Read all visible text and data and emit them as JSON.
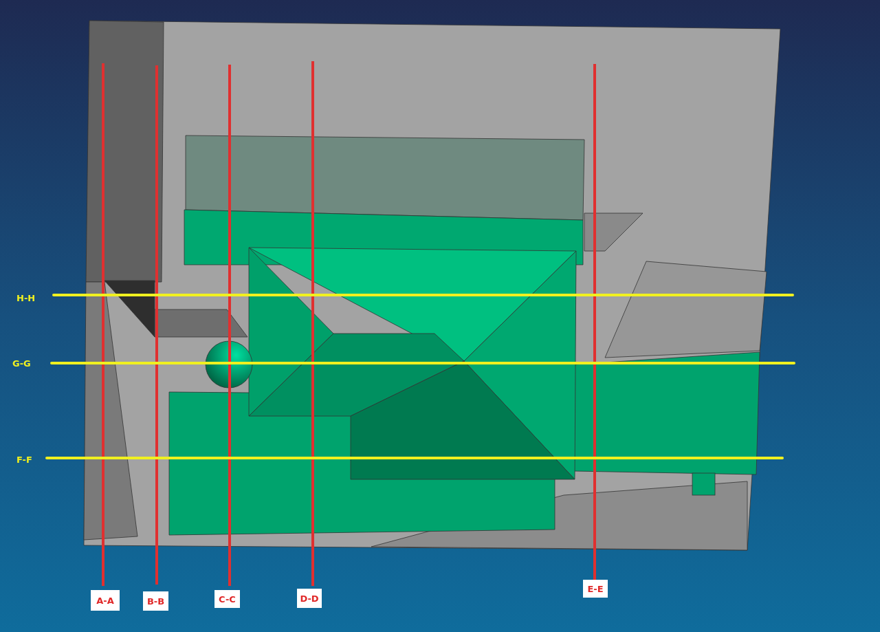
{
  "vertical_sections": [
    {
      "label": "A-A"
    },
    {
      "label": "B-B"
    },
    {
      "label": "C-C"
    },
    {
      "label": "D-D"
    },
    {
      "label": "E-E"
    }
  ],
  "horizontal_sections": [
    {
      "label": "H-H"
    },
    {
      "label": "G-G"
    },
    {
      "label": "F-F"
    }
  ]
}
